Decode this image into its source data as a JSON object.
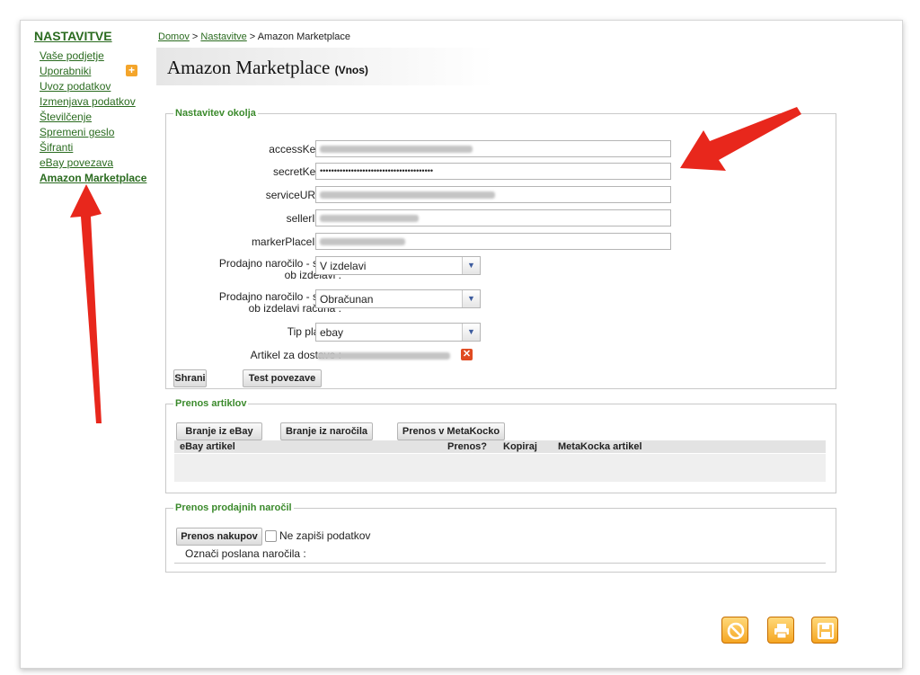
{
  "sidebar": {
    "title": "NASTAVITVE",
    "items": [
      {
        "label": "Vaše podjetje"
      },
      {
        "label": "Uporabniki"
      },
      {
        "label": "Uvoz podatkov"
      },
      {
        "label": "Izmenjava podatkov"
      },
      {
        "label": "Številčenje"
      },
      {
        "label": "Spremeni geslo"
      },
      {
        "label": "Šifranti"
      },
      {
        "label": "eBay povezava"
      },
      {
        "label": "Amazon Marketplace"
      }
    ]
  },
  "breadcrumb": {
    "home": "Domov",
    "sep1": " > ",
    "settings": "Nastavitve",
    "sep2": " > ",
    "current": "Amazon Marketplace"
  },
  "page": {
    "title": "Amazon Marketplace",
    "subtitle": "(Vnos)"
  },
  "settings_section": {
    "legend": "Nastavitev okolja",
    "required_mark": "(*)",
    "fields": [
      {
        "label": "accessKey",
        "value": ""
      },
      {
        "label": "secretKey",
        "value": "••••••••••••••••••••••••••••••••••••••••"
      },
      {
        "label": "serviceURL",
        "value": ""
      },
      {
        "label": "sellerId",
        "value": ""
      },
      {
        "label": "markerPlaceId",
        "value": ""
      }
    ],
    "selects": [
      {
        "label_line1": "Prodajno naročilo - status",
        "label_line2": "ob izdelavi :",
        "value": "V izdelavi"
      },
      {
        "label_line1": "Prodajno naročilo - status",
        "label_line2": "ob izdelavi računa :",
        "value": "Obračunan"
      },
      {
        "label_line1": "Tip plačila :",
        "label_line2": "",
        "value": "ebay"
      }
    ],
    "delivery_label": "Artikel za dostavo :",
    "save_button": "Shrani",
    "test_button": "Test povezave"
  },
  "articles_section": {
    "legend": "Prenos artiklov",
    "buttons": [
      "Branje iz eBay",
      "Branje iz naročila",
      "Prenos v MetaKocko"
    ],
    "columns": [
      "eBay artikel",
      "Prenos?",
      "Kopiraj",
      "MetaKocka artikel"
    ]
  },
  "orders_section": {
    "legend": "Prenos prodajnih naročil",
    "button": "Prenos nakupov",
    "checkbox_label": "Ne zapiši podatkov",
    "mark_label": "Označi poslana naročila :"
  },
  "colors": {
    "link_green": "#2a6b1f",
    "legend_green": "#3b8a2c",
    "required_red": "#cc0000",
    "arrow_red": "#e8271c",
    "action_orange": "#f5a623"
  }
}
